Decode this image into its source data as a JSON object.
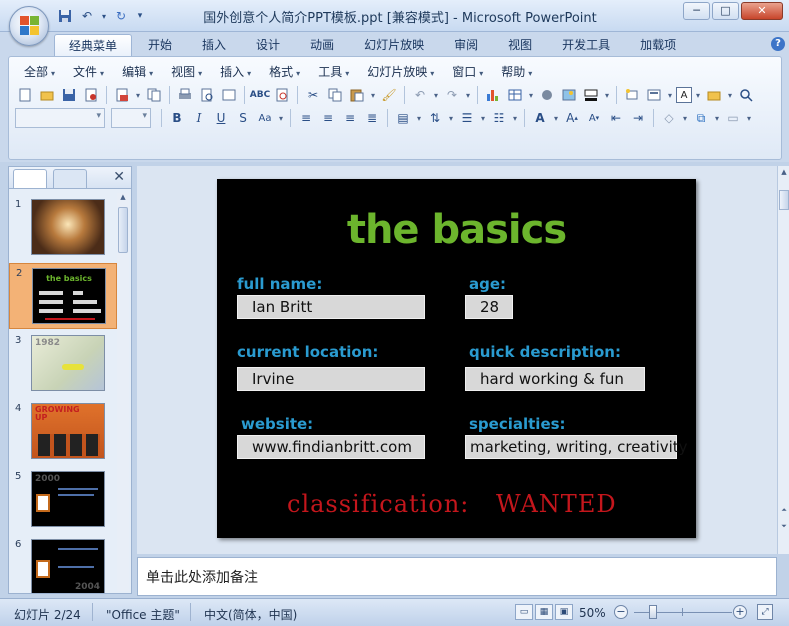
{
  "window": {
    "title": "国外创意个人简介PPT模板.ppt [兼容模式] - Microsoft PowerPoint",
    "minimize": "─",
    "maximize": "□",
    "close": "✕"
  },
  "ribbon_tabs": [
    {
      "label": "经典菜单",
      "active": true
    },
    {
      "label": "开始"
    },
    {
      "label": "插入"
    },
    {
      "label": "设计"
    },
    {
      "label": "动画"
    },
    {
      "label": "幻灯片放映"
    },
    {
      "label": "审阅"
    },
    {
      "label": "视图"
    },
    {
      "label": "开发工具"
    },
    {
      "label": "加载项"
    }
  ],
  "classic_menus": [
    "全部",
    "文件",
    "编辑",
    "视图",
    "插入",
    "格式",
    "工具",
    "幻灯片放映",
    "窗口",
    "帮助"
  ],
  "format_buttons": {
    "bold": "B",
    "italic": "I",
    "underline": "U",
    "strike": "S",
    "case": "Aa",
    "font_color": "A"
  },
  "slide": {
    "title": "the basics",
    "fields": {
      "full_name_label": "full name:",
      "full_name_value": "Ian Britt",
      "age_label": "age:",
      "age_value": "28",
      "location_label": "current location:",
      "location_value": "Irvine",
      "description_label": "quick description:",
      "description_value": "hard working & fun",
      "website_label": "website:",
      "website_value": "www.findianbritt.com",
      "specialties_label": "specialties:",
      "specialties_value": "marketing, writing, creativity"
    },
    "classification_label": "classification:",
    "classification_value": "WANTED"
  },
  "thumbnails": [
    {
      "num": "1"
    },
    {
      "num": "2",
      "selected": true,
      "caption": "the basics"
    },
    {
      "num": "3",
      "caption": "1982"
    },
    {
      "num": "4",
      "caption": "GROWING UP"
    },
    {
      "num": "5",
      "caption": "2000"
    },
    {
      "num": "6",
      "caption": "2004"
    }
  ],
  "notes_placeholder": "单击此处添加备注",
  "status": {
    "slide_position": "幻灯片 2/24",
    "theme": "\"Office 主题\"",
    "language": "中文(简体，中国)",
    "zoom": "50%"
  },
  "colors": {
    "slide_title": "#6cb52d",
    "slide_labels": "#2a9bd0",
    "classification": "#c4161c",
    "selected_thumb": "#f3b276"
  }
}
